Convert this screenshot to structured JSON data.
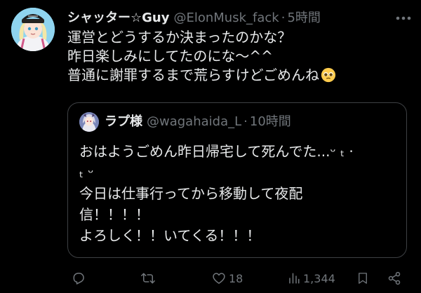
{
  "tweet": {
    "display_name": "シャッター☆Guy",
    "handle": "@ElonMusk_fack",
    "dot": "·",
    "time": "5時間",
    "lines": [
      "運営とどうするか決まったのかな？",
      "昨日楽しみにしてたのにな〜^^",
      "普通に謝罪するまで荒らすけどごめんね"
    ],
    "emoji_icon": "pleading-face-emoji",
    "avatar_icon": "anime-avatar-icon"
  },
  "quote": {
    "display_name": "ラプ様",
    "handle": "@wagahaida_L",
    "dot": "·",
    "time": "10時間",
    "lines": [
      "おはようごめん昨日帰宅して死んでた...ᵕ ₜ · ",
      "ₜ ᵕ",
      "今日は仕事行ってから移動して夜配",
      "信！！！！",
      "よろしく！！いてくる！！！"
    ],
    "avatar_icon": "anime-avatar-icon"
  },
  "actions": {
    "reply_icon": "reply-icon",
    "retweet_icon": "retweet-icon",
    "like_icon": "heart-icon",
    "like_count": "18",
    "views_icon": "views-chart-icon",
    "views_count": "1,344",
    "bookmark_icon": "bookmark-icon",
    "share_icon": "share-icon"
  },
  "colors": {
    "background": "#000000",
    "text": "#e7e9ea",
    "secondary": "#71767b",
    "border": "#3e4144"
  }
}
